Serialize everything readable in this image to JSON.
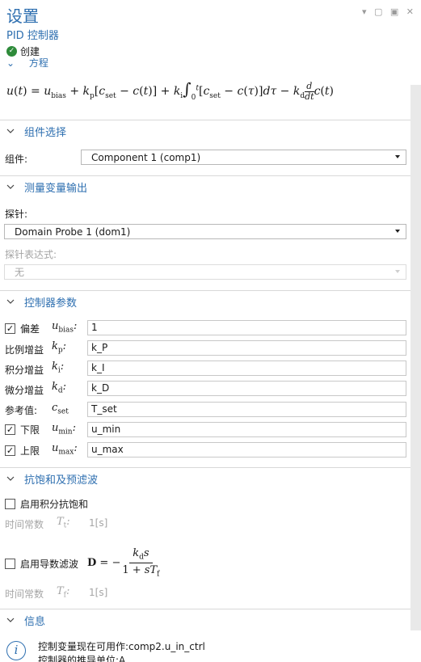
{
  "header": {
    "title": "设置",
    "subtitle": "PID 控制器",
    "status": "创建",
    "cut_section": "方程"
  },
  "equation": {
    "lhs": "u(t) =",
    "bias": "u",
    "bias_sub": "bias",
    "kp": "k",
    "kp_sub": "p",
    "ki": "k",
    "ki_sub": "i",
    "kd": "k",
    "kd_sub": "d",
    "cset_sub": "set"
  },
  "component_section": {
    "title": "组件选择",
    "label": "组件:",
    "value": "Component 1 (comp1)"
  },
  "probe_section": {
    "title": "测量变量输出",
    "probe_label": "探针:",
    "probe_value": "Domain Probe 1 (dom1)",
    "expr_label": "探针表达式:",
    "expr_value": "无"
  },
  "params_section": {
    "title": "控制器参数",
    "rows": [
      {
        "label": "偏差",
        "sym": "u",
        "sub": "bias",
        "value": "1",
        "checkbox": true
      },
      {
        "label": "比例增益",
        "sym": "k",
        "sub": "p",
        "value": "k_P",
        "checkbox": false
      },
      {
        "label": "积分增益",
        "sym": "k",
        "sub": "i",
        "value": "k_I",
        "checkbox": false
      },
      {
        "label": "微分增益",
        "sym": "k",
        "sub": "d",
        "value": "k_D",
        "checkbox": false
      },
      {
        "label": "参考值:",
        "sym": "c",
        "sub": "set",
        "value": "T_set",
        "checkbox": false
      },
      {
        "label": "下限",
        "sym": "u",
        "sub": "min",
        "value": "u_min",
        "checkbox": true
      },
      {
        "label": "上限",
        "sym": "u",
        "sub": "max",
        "value": "u_max",
        "checkbox": true
      }
    ]
  },
  "filter_section": {
    "title": "抗饱和及预滤波",
    "windup_label": "启用积分抗饱和",
    "time_const_label": "时间常数",
    "tt_sym": "T",
    "tt_sub": "t",
    "tt_value": "1[s]",
    "deriv_label": "启用导数滤波",
    "formula_lhs": "D",
    "tf_sym": "T",
    "tf_sub": "f",
    "tf_value": "1[s]"
  },
  "info_section": {
    "title": "信息",
    "line1": "控制变量现在可用作:comp2.u_in_ctrl",
    "line2": "控制器的推导单位:A"
  }
}
